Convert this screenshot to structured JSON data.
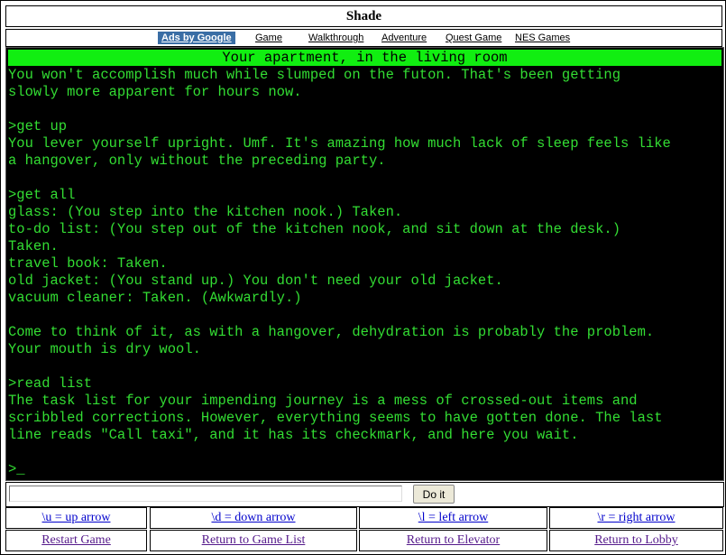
{
  "title": "Shade",
  "ads_bar": {
    "ads_label": "Ads by Google",
    "links": [
      "Game",
      "Walkthrough",
      "Adventure",
      "Quest Game",
      "NES Games"
    ]
  },
  "terminal": {
    "status": "Your apartment, in the living room",
    "lines": [
      "You won't accomplish much while slumped on the futon. That's been getting",
      "slowly more apparent for hours now.",
      "",
      ">get up",
      "You lever yourself upright. Umf. It's amazing how much lack of sleep feels like",
      "a hangover, only without the preceding party.",
      "",
      ">get all",
      "glass: (You step into the kitchen nook.) Taken.",
      "to-do list: (You step out of the kitchen nook, and sit down at the desk.)",
      "Taken.",
      "travel book: Taken.",
      "old jacket: (You stand up.) You don't need your old jacket.",
      "vacuum cleaner: Taken. (Awkwardly.)",
      "",
      "Come to think of it, as with a hangover, dehydration is probably the problem.",
      "Your mouth is dry wool.",
      "",
      ">read list",
      "The task list for your impending journey is a mess of crossed-out items and",
      "scribbled corrections. However, everything seems to have gotten done. The last",
      "line reads \"Call taxi\", and it has its checkmark, and here you wait.",
      "",
      ">_"
    ]
  },
  "command": {
    "input_value": "",
    "button_label": "Do it"
  },
  "arrow_keys": [
    "\\u = up arrow",
    "\\d = down arrow",
    "\\l = left arrow",
    "\\r = right arrow"
  ],
  "bottom_links": [
    "Restart Game",
    "Return to Game List",
    "Return to Elevator",
    "Return to Lobby"
  ]
}
